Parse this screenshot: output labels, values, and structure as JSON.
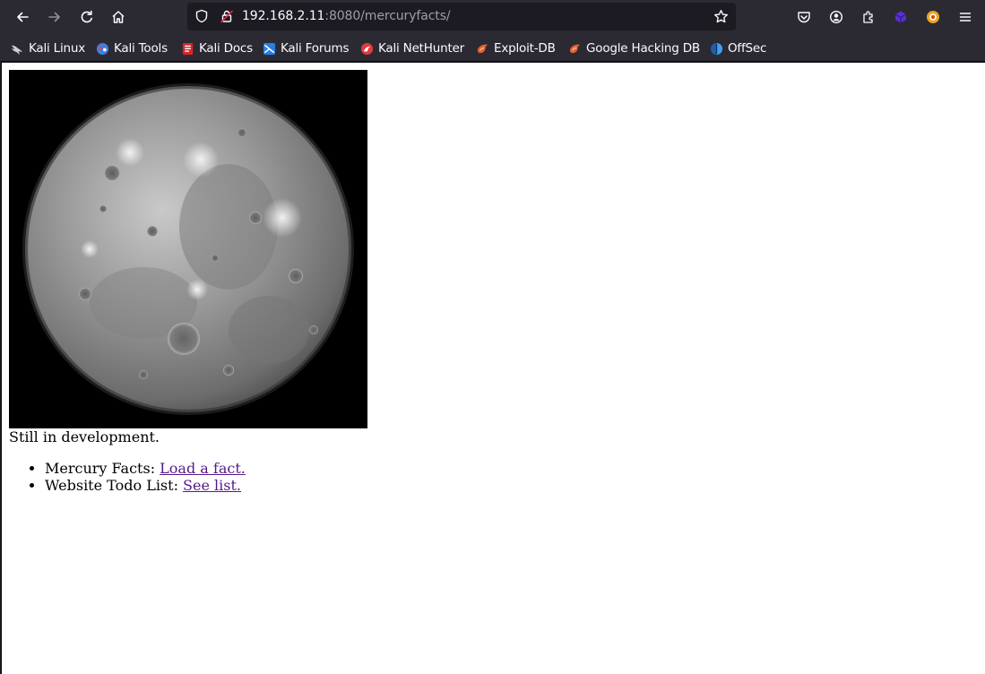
{
  "browser": {
    "url_host": "192.168.2.11",
    "url_rest": ":8080/mercuryfacts/",
    "bookmarks": [
      {
        "label": "Kali Linux",
        "icon": "kali-dragon-icon"
      },
      {
        "label": "Kali Tools",
        "icon": "kali-tools-icon"
      },
      {
        "label": "Kali Docs",
        "icon": "kali-docs-icon"
      },
      {
        "label": "Kali Forums",
        "icon": "kali-forums-icon"
      },
      {
        "label": "Kali NetHunter",
        "icon": "kali-nethunter-icon"
      },
      {
        "label": "Exploit-DB",
        "icon": "exploit-db-icon"
      },
      {
        "label": "Google Hacking DB",
        "icon": "ghdb-icon"
      },
      {
        "label": "OffSec",
        "icon": "offsec-icon"
      }
    ]
  },
  "page": {
    "status_text": "Still in development.",
    "items": [
      {
        "label": "Mercury Facts: ",
        "link": "Load a fact."
      },
      {
        "label": "Website Todo List: ",
        "link": "See list."
      }
    ]
  },
  "colors": {
    "chrome": "#2b2a33",
    "urlbar": "#1c1b22",
    "visited_link": "#551a8b"
  }
}
